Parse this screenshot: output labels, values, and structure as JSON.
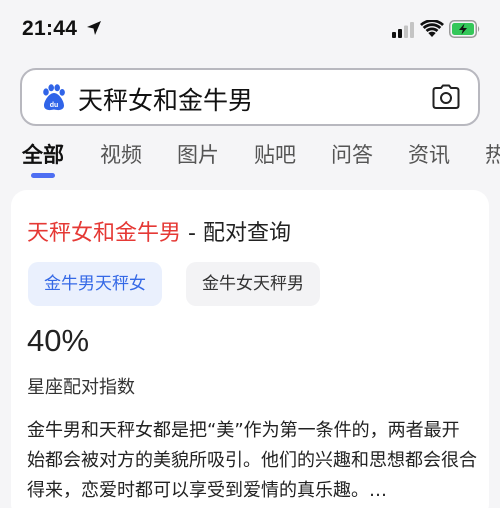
{
  "status_bar": {
    "time": "21:44",
    "icons": [
      "location-arrow-icon",
      "cellular-signal-icon",
      "wifi-icon",
      "battery-charging-icon"
    ],
    "battery_color": "#34c759"
  },
  "search": {
    "logo": "baidu-paw-icon",
    "query": "天秤女和金牛男",
    "camera_icon": "camera-icon",
    "border_color": "#b8b8bf"
  },
  "tabs": [
    {
      "label": "全部",
      "active": true
    },
    {
      "label": "视频",
      "active": false
    },
    {
      "label": "图片",
      "active": false
    },
    {
      "label": "贴吧",
      "active": false
    },
    {
      "label": "问答",
      "active": false
    },
    {
      "label": "资讯",
      "active": false
    },
    {
      "label": "热",
      "active": false
    }
  ],
  "accent_color": "#4e6ef2",
  "result": {
    "title_highlight": "天秤女和金牛男",
    "title_rest": " - 配对查询",
    "chips": [
      "金牛男天秤女",
      "金牛女天秤男"
    ],
    "percent": "40%",
    "index_label": "星座配对指数",
    "description": "金牛男和天秤女都是把“美”作为第一条件的，两者最开始都会被对方的美貌所吸引。他们的兴趣和思想都会很合得来，恋爱时都可以享受到爱情的真乐趣。…"
  }
}
